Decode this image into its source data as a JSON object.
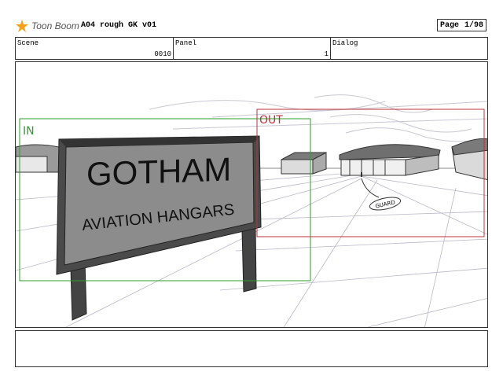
{
  "header": {
    "logo_text": "Toon Boom",
    "doc_title": "A04 rough GK v01",
    "page_label": "Page",
    "page_value": "1/98"
  },
  "meta": {
    "scene_label": "Scene",
    "scene_value": "0010",
    "panel_label": "Panel",
    "panel_value": "1",
    "dialog_label": "Dialog",
    "dialog_value": ""
  },
  "panel": {
    "in_label": "IN",
    "out_label": "OUT",
    "in_color": "#2e9e2e",
    "out_color": "#c0303a",
    "sign_line1": "GOTHAM",
    "sign_line2": "AVIATION HANGARS",
    "guard_label": "GUARD"
  },
  "dialog_area": {
    "text": ""
  }
}
